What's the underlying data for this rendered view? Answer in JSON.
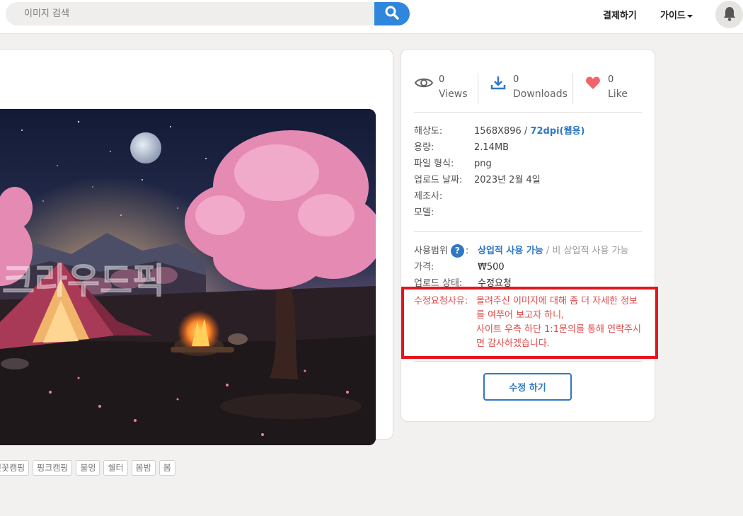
{
  "header": {
    "search_placeholder": "이미지 검색",
    "nav_pay": "결제하기",
    "nav_guide": "가이드"
  },
  "image": {
    "watermark": "크라우드픽"
  },
  "tags": [
    "벚꽃캠핑",
    "핑크캠핑",
    "불멍",
    "쉘터",
    "봄밤",
    "봄"
  ],
  "stats": {
    "views": {
      "count": "0",
      "label": "Views"
    },
    "downloads": {
      "count": "0",
      "label": "Downloads"
    },
    "likes": {
      "count": "0",
      "label": "Like"
    }
  },
  "info": {
    "resolution_label": "해상도:",
    "resolution_value": "1568X896 /",
    "resolution_dpi": "72dpi(웹용)",
    "size_label": "용량:",
    "size_value": "2.14MB",
    "format_label": "파일 형식:",
    "format_value": "png",
    "date_label": "업로드 날짜:",
    "date_value": "2023년 2월 4일",
    "maker_label": "제조사:",
    "model_label": "모델:"
  },
  "usage": {
    "scope_label": "사용범위",
    "help": "?",
    "commercial": "상업적 사용 가능",
    "noncommercial": "/ 비 상업적 사용 가능",
    "price_label": "가격:",
    "price_value": "₩500",
    "status_label": "업로드 상태:",
    "status_value": "수정요청"
  },
  "reason": {
    "label": "수정요청사유:",
    "line1": "올려주신 이미지에 대해 좀 더 자세한 정보를 여쭈어 보고자 하니,",
    "line2": "사이트 우측 하단 1:1문의를 통해 연락주시면 감사하겠습니다."
  },
  "actions": {
    "edit_label": "수정 하기"
  },
  "colors": {
    "accent": "#2f78c4",
    "search_button": "#2f86dd",
    "alert_red": "#e04a4a",
    "highlight_border": "#e6141e",
    "heart": "#f0656b"
  }
}
